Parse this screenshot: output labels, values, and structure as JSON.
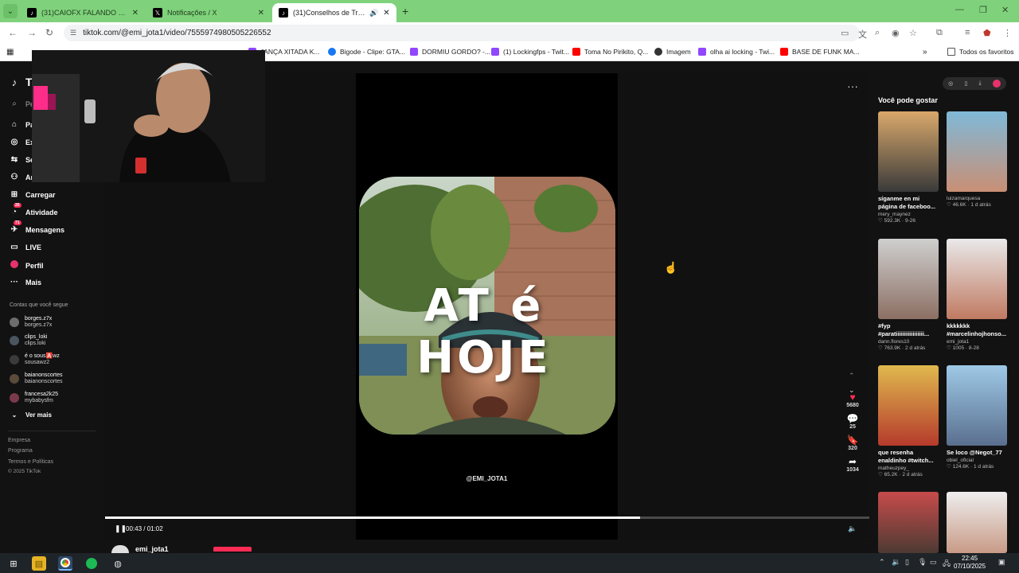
{
  "browser": {
    "tabs": [
      {
        "title": "(31)CAIOFX FALANDO DO ALBUM",
        "favicon": "tiktok",
        "active": false
      },
      {
        "title": "Notificações / X",
        "favicon": "x",
        "active": false
      },
      {
        "title": "(31)Conselhos de Trabalho",
        "favicon": "tiktok",
        "active": true
      }
    ],
    "url": "tiktok.com/@emi_jota1/video/7555974980505226552",
    "bookmarks": [
      {
        "label": "JANÇA XITADA K...",
        "icon": "bookmark-purple"
      },
      {
        "label": "Bigode - Clipe: GTA...",
        "icon": "facebook"
      },
      {
        "label": "DORMIU GORDO? -...",
        "icon": "twitch"
      },
      {
        "label": "(1) Lockingfps - Twit...",
        "icon": "twitch"
      },
      {
        "label": "Toma No Pirikito, Q...",
        "icon": "youtube"
      },
      {
        "label": "Imagem",
        "icon": "globe"
      },
      {
        "label": "olha ai locking - Twi...",
        "icon": "twitch"
      },
      {
        "label": "BASE DE FUNK MA...",
        "icon": "youtube"
      }
    ],
    "all_favorites": "Todos os favoritos"
  },
  "tiktok": {
    "logo": "TikTok",
    "search_placeholder": "Pesquisar",
    "nav": [
      {
        "label": "Para você",
        "icon": "home-icon"
      },
      {
        "label": "Explorar",
        "icon": "compass-icon"
      },
      {
        "label": "Seguindo",
        "icon": "following-icon"
      },
      {
        "label": "Amigos",
        "icon": "friends-icon"
      },
      {
        "label": "Carregar",
        "icon": "upload-icon"
      },
      {
        "label": "Atividade",
        "icon": "activity-icon",
        "badge": "20"
      },
      {
        "label": "Mensagens",
        "icon": "messages-icon",
        "badge": "71"
      },
      {
        "label": "LIVE",
        "icon": "live-icon"
      },
      {
        "label": "Perfil",
        "icon": "profile-icon"
      },
      {
        "label": "Mais",
        "icon": "more-icon"
      }
    ],
    "following_title": "Contas que você segue",
    "following": [
      {
        "name": "borges.z7x",
        "handle": "borges.z7x"
      },
      {
        "name": "clips_loki",
        "handle": "clips.loki"
      },
      {
        "name": "é o sous🅰️wz",
        "handle": "sousawz2"
      },
      {
        "name": "baianonscortes",
        "handle": "baianonscortes"
      },
      {
        "name": "francesa2k25",
        "handle": "mybabysfm"
      }
    ],
    "see_more": "Ver mais",
    "footer": [
      "Empresa",
      "Programa",
      "Termos e Políticas",
      "© 2025 TikTok"
    ]
  },
  "video": {
    "overlay_text": "AT é  HOJE",
    "watermark": "@EMI_JOTA1",
    "time": "00:43 / 01:02",
    "progress": 0.7,
    "likes": "5680",
    "comments": "25",
    "saves": "320",
    "shares": "1034",
    "author": "emi_jota1"
  },
  "rail": {
    "title": "Você pode gostar",
    "cards": [
      {
        "caption": "síganme en mi página de faceboo...",
        "user": "mery_maynez",
        "meta": "♡ 592.3K · 9-26"
      },
      {
        "caption": "",
        "user": "luizamarquesa",
        "meta": "♡ 46.6K · 1 d atrás"
      },
      {
        "caption": "#fyp #paratiiiiiiiiiiiiiiiii...",
        "user": "dann.flores10",
        "meta": "♡ 763.9K · 2 d atrás"
      },
      {
        "caption": "kkkkkkk #marcelinhojhonso...",
        "user": "emi_jota1",
        "meta": "♡ 1005 · 8-28"
      },
      {
        "caption": "que resenha enaldinho #twitch...",
        "user": "matheuzpey_",
        "meta": "♡ 65.2K · 2 d atrás"
      },
      {
        "caption": "Se loco @Negot_77",
        "user": "obiel_oficial",
        "meta": "♡ 124.6K · 1 d atrás"
      },
      {
        "caption": "",
        "user": "",
        "meta": ""
      },
      {
        "caption": "",
        "user": "",
        "meta": ""
      }
    ]
  },
  "taskbar": {
    "time": "22:45",
    "date": "07/10/2025"
  }
}
